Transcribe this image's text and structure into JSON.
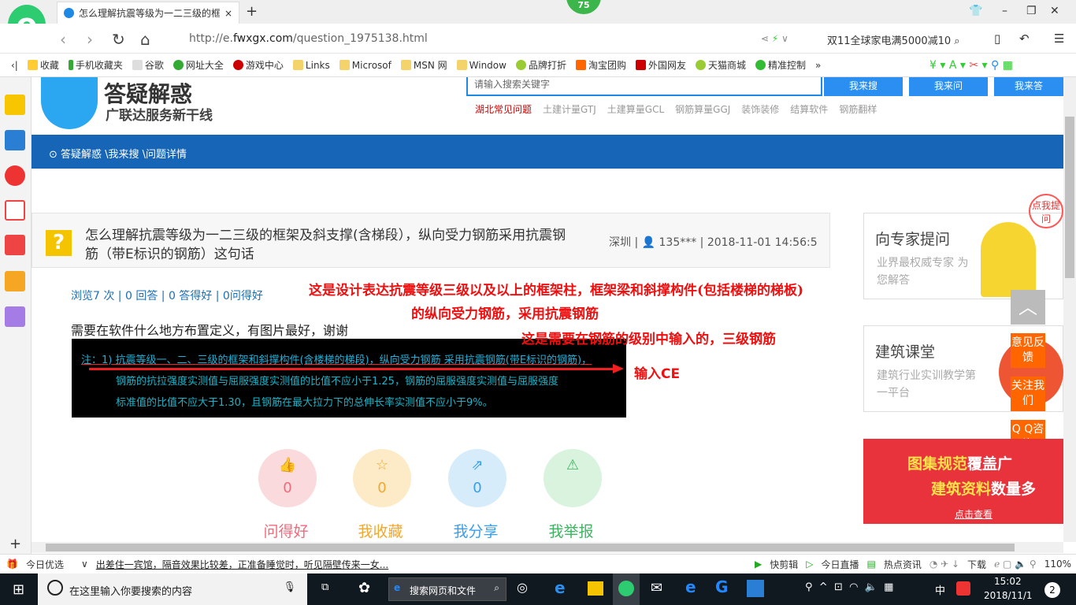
{
  "browser": {
    "tab_title": "怎么理解抗震等级为一二三级的框",
    "badge": "75",
    "url_prefix": "http://e.",
    "url_domain": "fwxgx.com",
    "url_path": "/question_1975138.html",
    "search_text": "双11全球家电满5000减10"
  },
  "bookmarks": [
    "收藏",
    "手机收藏夹",
    "谷歌",
    "网址大全",
    "游戏中心",
    "Links",
    "Microsof",
    "MSN 网",
    "Window",
    "品牌打折",
    "淘宝团购",
    "外国网友",
    "天猫商城",
    "精准控制",
    "»"
  ],
  "header": {
    "logo_title": "答疑解惑",
    "logo_sub": "广联达服务新干线",
    "search_placeholder": "请输入搜索关键字",
    "btn_search": "我来搜",
    "btn_ask": "我来问",
    "btn_answer": "我来答",
    "hot_links": [
      "湖北常见问题",
      "土建计量GTJ",
      "土建算量GCL",
      "钢筋算量GGJ",
      "装饰装修",
      "结算软件",
      "钢筋翻样"
    ]
  },
  "breadcrumb": "答疑解惑 \\我来搜 \\问题详情",
  "question": {
    "title": "怎么理解抗震等级为一二三级的框架及斜支撑(含梯段），纵向受力钢筋采用抗震钢筋（带E标识的钢筋）这句话",
    "meta": "深圳 | 👤 135*** | 2018-11-01 14:56:5",
    "stats": "浏览7 次 | 0 回答 | 0 答得好 | 0问得好",
    "body": "需要在软件什么地方布置定义，有图片最好，谢谢",
    "image_lines": [
      "注：1) 抗震等级一、二、三级的框架和斜撑构件(含楼梯的梯段)，纵向受力钢筋  采用抗震钢筋(带E标识的钢筋)，",
      "钢筋的抗拉强度实测值与屈服强度实测值的比值不应小于1.25，钢筋的屈服强度实测值与屈服强度",
      "标准值的比值不应大于1.30，且钢筋在最大拉力下的总伸长率实测值不应小于9%。"
    ]
  },
  "annotations": {
    "line1": "这是设计表达抗震等级三级以及以上的框架柱，框架梁和斜撑构件(包括楼梯的梯板)",
    "line2": "的纵向受力钢筋，采用抗震钢筋",
    "line3": "这是需要在钢筋的级别中输入的，三级钢筋",
    "line4": "输入CE"
  },
  "actions": [
    {
      "label": "问得好",
      "count": "0",
      "icon": "thumbs-up",
      "color": "#fadadd"
    },
    {
      "label": "我收藏",
      "count": "0",
      "icon": "star",
      "color": "#fdebc8"
    },
    {
      "label": "我分享",
      "count": "0",
      "icon": "share",
      "color": "#d6ecfb"
    },
    {
      "label": "我举报",
      "count": "0",
      "icon": "warning",
      "color": "#daf3df"
    }
  ],
  "sidebar_cards": [
    {
      "title": "向专家提问",
      "sub": "业界最权威专家 为您解答"
    },
    {
      "title": "建筑课堂",
      "sub": "建筑行业实训教学第一平台"
    }
  ],
  "bubble": "点我提问",
  "float_buttons": [
    "意见反馈",
    "关注我们",
    "Q Q咨询"
  ],
  "banner": {
    "line1a": "图集规范",
    "line1b": "覆盖广",
    "line2a": "建筑资料",
    "line2b": "数量多",
    "cta": "点击查看"
  },
  "statusbar": {
    "today": "今日优选",
    "news": "出差住一宾馆，隔音效果比较差，正准备睡觉时，听见隔壁传来一女...",
    "items": [
      "快剪辑",
      "今日直播",
      "热点资讯",
      "下载"
    ],
    "zoom": "110%"
  },
  "taskbar": {
    "search_placeholder": "在这里输入你要搜索的内容",
    "web_search": "搜索网页和文件",
    "ime": "中",
    "time": "15:02",
    "date": "2018/11/1",
    "notif": "2"
  }
}
